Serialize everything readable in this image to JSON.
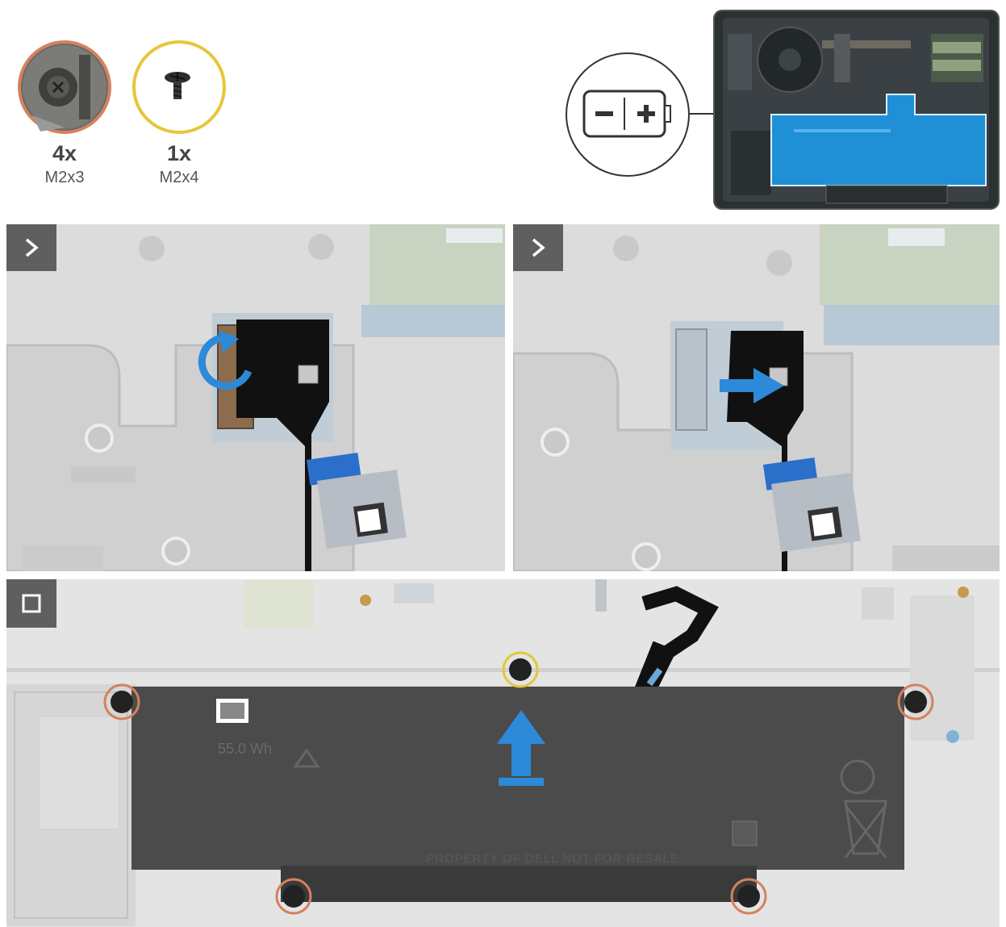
{
  "screws": [
    {
      "count": "4x",
      "size": "M2x3",
      "ring_color": "#d4825e",
      "icon": "screw-head-m2x3-icon"
    },
    {
      "count": "1x",
      "size": "M2x4",
      "ring_color": "#e6c63a",
      "icon": "screw-m2x4-icon"
    }
  ],
  "battery_label": {
    "minus": "−",
    "plus": "+",
    "icon": "battery-icon"
  },
  "steps": [
    {
      "badge": "chevron-right-icon",
      "action": "rotate-arrow-icon"
    },
    {
      "badge": "chevron-right-icon",
      "action": "push-arrow-icon"
    },
    {
      "badge": "square-stop-icon",
      "action": "lift-arrow-icon"
    }
  ],
  "battery": {
    "capacity": "55.0 Wh",
    "footer_text": "PROPERTY OF DELL NOT FOR RESALE"
  },
  "colors": {
    "highlight_blue": "#1f8fd6",
    "arrow_blue": "#2c8ad8",
    "badge_gray": "#5f5f5f",
    "orange_ring": "#d4825e",
    "yellow_ring": "#e6c63a"
  }
}
